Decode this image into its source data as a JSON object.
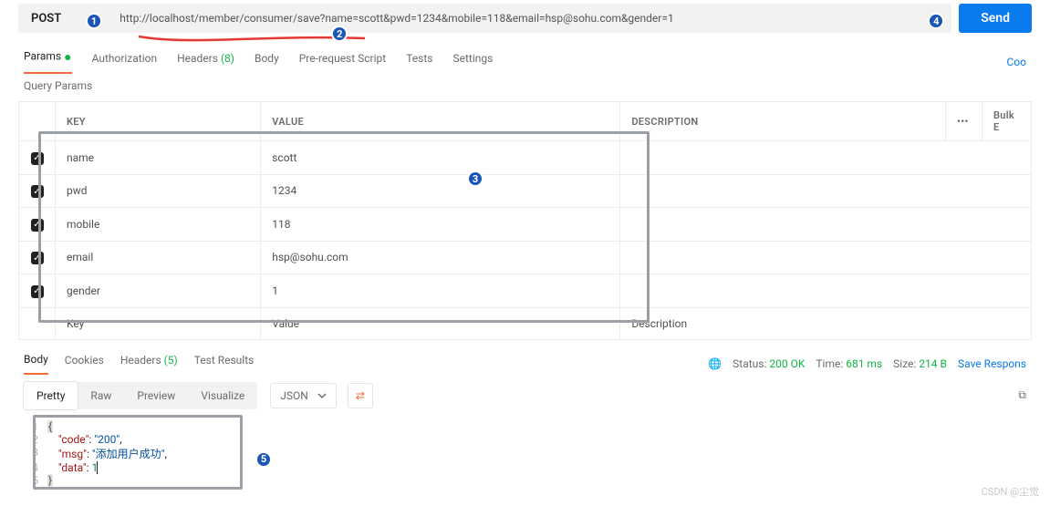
{
  "request": {
    "method": "POST",
    "url": "http://localhost/member/consumer/save?name=scott&pwd=1234&mobile=118&email=hsp@sohu.com&gender=1",
    "sendLabel": "Send"
  },
  "requestTabs": {
    "params": "Params",
    "auth": "Authorization",
    "headers": "Headers",
    "headersCount": "(8)",
    "body": "Body",
    "preReq": "Pre-request Script",
    "tests": "Tests",
    "settings": "Settings",
    "cookiesLink": "Coo"
  },
  "querySection": {
    "title": "Query Params",
    "cols": {
      "key": "KEY",
      "value": "VALUE",
      "desc": "DESCRIPTION",
      "bulk": "Bulk E"
    },
    "rows": [
      {
        "checked": true,
        "key": "name",
        "value": "scott",
        "desc": ""
      },
      {
        "checked": true,
        "key": "pwd",
        "value": "1234",
        "desc": ""
      },
      {
        "checked": true,
        "key": "mobile",
        "value": "118",
        "desc": ""
      },
      {
        "checked": true,
        "key": "email",
        "value": "hsp@sohu.com",
        "desc": ""
      },
      {
        "checked": true,
        "key": "gender",
        "value": "1",
        "desc": ""
      }
    ],
    "placeholderKey": "Key",
    "placeholderValue": "Value",
    "placeholderDesc": "Description"
  },
  "responseTabs": {
    "body": "Body",
    "cookies": "Cookies",
    "headers": "Headers",
    "headersCount": "(5)",
    "testResults": "Test Results"
  },
  "responseMeta": {
    "statusLabel": "Status:",
    "statusValue": "200 OK",
    "timeLabel": "Time:",
    "timeValue": "681 ms",
    "sizeLabel": "Size:",
    "sizeValue": "214 B",
    "saveResp": "Save Respons"
  },
  "viewModes": {
    "pretty": "Pretty",
    "raw": "Raw",
    "preview": "Preview",
    "visualize": "Visualize",
    "lang": "JSON"
  },
  "responseBody": {
    "code": "200",
    "msg": "添加用户成功",
    "data": 1
  },
  "annotations": {
    "b1": "1",
    "b2": "2",
    "b3": "3",
    "b4": "4",
    "b5": "5"
  },
  "watermark": "CSDN @尘觉"
}
